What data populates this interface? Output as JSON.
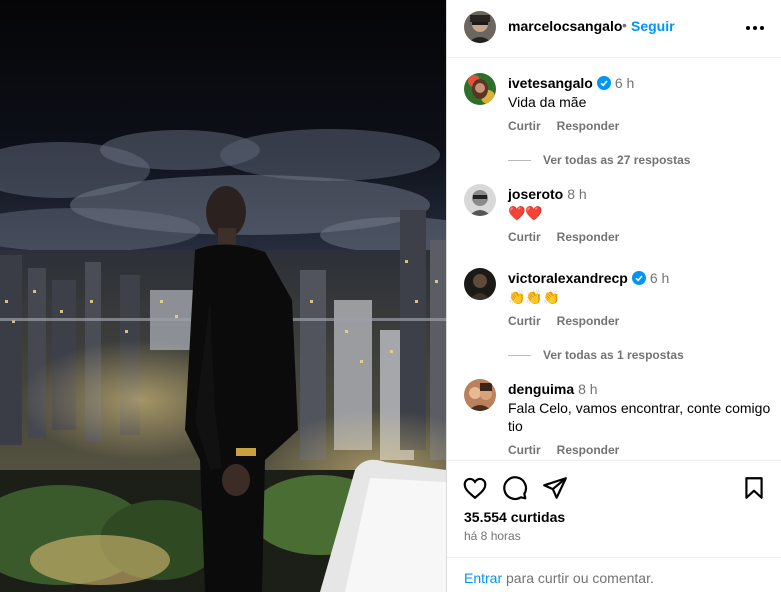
{
  "post": {
    "author": "marcelocsangalo",
    "separator": "•",
    "follow_label": "Seguir",
    "more_icon": "more-horizontal-icon"
  },
  "comments": [
    {
      "user": "ivetesangalo",
      "verified": true,
      "time": "6 h",
      "text": "Vida da mãe",
      "like_label": "Curtir",
      "reply_label": "Responder",
      "view_replies": "Ver todas as 27 respostas"
    },
    {
      "user": "joseroto",
      "verified": false,
      "time": "8 h",
      "text": "❤️❤️",
      "like_label": "Curtir",
      "reply_label": "Responder"
    },
    {
      "user": "victoralexandrecp",
      "verified": true,
      "time": "6 h",
      "text": "👏👏👏",
      "like_label": "Curtir",
      "reply_label": "Responder",
      "view_replies": "Ver todas as 1 respostas"
    },
    {
      "user": "denguima",
      "verified": false,
      "time": "8 h",
      "text": "Fala Celo, vamos encontrar, conte comigo tio",
      "like_label": "Curtir",
      "reply_label": "Responder"
    }
  ],
  "actions": {
    "like_icon": "heart-icon",
    "comment_icon": "comment-bubble-icon",
    "share_icon": "paper-plane-icon",
    "save_icon": "bookmark-icon",
    "likes": "35.554 curtidas",
    "posted": "há 8 horas"
  },
  "login": {
    "link": "Entrar",
    "suffix": " para curtir ou comentar."
  },
  "colors": {
    "accent": "#0095f6",
    "secondary_text": "#737373",
    "verified": "#0095f6",
    "divider": "#dbdbdb"
  }
}
